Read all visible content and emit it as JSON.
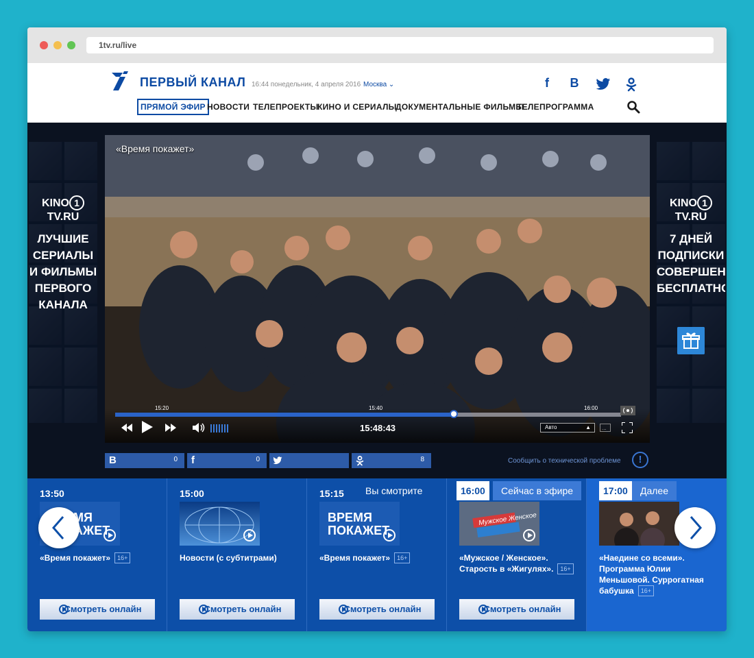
{
  "browser": {
    "url": "1tv.ru/live"
  },
  "header": {
    "brand": "ПЕРВЫЙ КАНАЛ",
    "datetime": "16:44 понедельник, 4 апреля 2016",
    "city": "Москва",
    "social": [
      {
        "icon": "facebook-icon",
        "glyph": "f"
      },
      {
        "icon": "vkontakte-icon",
        "glyph": "B"
      },
      {
        "icon": "twitter-icon",
        "glyph": "🐦"
      },
      {
        "icon": "odnoklassniki-icon",
        "glyph": "ok"
      }
    ],
    "nav": [
      "ПРЯМОЙ ЭФИР",
      "НОВОСТИ",
      "ТЕЛЕПРОЕКТЫ",
      "КИНО И СЕРИАЛЫ",
      "ДОКУМЕНТАЛЬНЫЕ ФИЛЬМЫ",
      "ТЕЛЕПРОГРАММА"
    ],
    "brand_color": "#0c4aa3"
  },
  "side_promos": {
    "left": {
      "logo": "KINO",
      "logo_suffix": "TV.RU",
      "logo_one": "1",
      "text": "ЛУЧШИЕ\nСЕРИАЛЫ\nИ ФИЛЬМЫ\nПЕРВОГО\nКАНАЛА"
    },
    "right": {
      "logo": "KINO",
      "logo_suffix": "TV.RU",
      "logo_one": "1",
      "text": "7 ДНЕЙ\nПОДПИСКИ\nСОВЕРШЕННО\nБЕСПЛАТНО",
      "gift_icon": "gift-icon"
    }
  },
  "player": {
    "show_title": "«Время покажет»",
    "current_time": "15:48:43",
    "ticks": [
      "15:20",
      "15:40",
      "16:00"
    ],
    "progress_fraction": 0.67,
    "quality": "Авто"
  },
  "share": {
    "items": [
      {
        "icon": "vkontakte-icon",
        "glyph": "B",
        "count": "0"
      },
      {
        "icon": "facebook-icon",
        "glyph": "f",
        "count": "0"
      },
      {
        "icon": "twitter-icon",
        "glyph": "🐦",
        "count": ""
      },
      {
        "icon": "odnoklassniki-icon",
        "glyph": "ok",
        "count": "8"
      }
    ],
    "report": "Сообщить о технической проблеме"
  },
  "schedule": {
    "watch_label": "Смотреть онлайн",
    "slots": [
      {
        "time": "13:50",
        "status": "",
        "thumb_text": "ВРЕМЯ\nПОКАЖЕТ",
        "title": "«Время покажет»",
        "age": "16+"
      },
      {
        "time": "15:00",
        "status": "",
        "thumb_text": "",
        "title": "Новости (с субтитрами)",
        "age": ""
      },
      {
        "time": "15:15",
        "status": "Вы смотрите",
        "thumb_text": "ВРЕМЯ\nПОКАЖЕТ",
        "title": "«Время покажет»",
        "age": "16+"
      },
      {
        "time": "16:00",
        "status": "Сейчас в эфире",
        "thumb_text": "Мужское Женское",
        "title": "«Мужское / Женское». Старость в «Жигулях».",
        "age": "16+"
      },
      {
        "time": "17:00",
        "status": "Далее",
        "thumb_text": "",
        "title": "«Наедине со всеми». Программа Юлии Меньшовой. Суррогатная бабушка",
        "age": "16+"
      }
    ]
  }
}
